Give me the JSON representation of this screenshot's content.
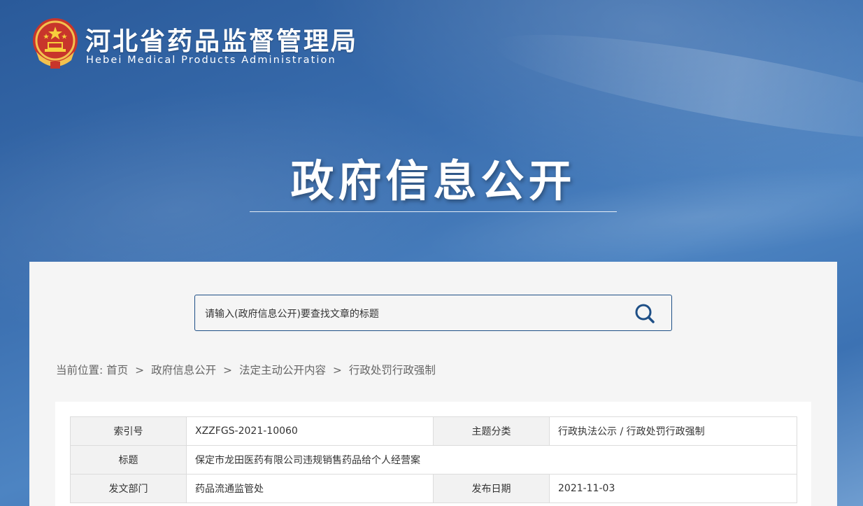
{
  "header": {
    "site_name": "河北省药品监督管理局",
    "site_name_en": "Hebei Medical Products Administration",
    "logo_icon": "national-emblem-icon",
    "section_title": "政府信息公开"
  },
  "search": {
    "placeholder": "请输入(政府信息公开)要查找文章的标题",
    "icon": "search-icon"
  },
  "breadcrumb": {
    "prefix": "当前位置:",
    "items": [
      "首页",
      "政府信息公开",
      "法定主动公开内容",
      "行政处罚行政强制"
    ],
    "separator": ">"
  },
  "meta": {
    "rows": [
      {
        "k1": "索引号",
        "v1": "XZZFGS-2021-10060",
        "k2": "主题分类",
        "v2": "行政执法公示 / 行政处罚行政强制"
      },
      {
        "k1": "标题",
        "v1": "保定市龙田医药有限公司违规销售药品给个人经营案"
      },
      {
        "k1": "发文部门",
        "v1": "药品流通监管处",
        "k2": "发布日期",
        "v2": "2021-11-03"
      }
    ]
  },
  "colors": {
    "banner_blue": "#2e62a3",
    "search_border": "#1e4f86",
    "panel_bg": "#f5f5f5"
  }
}
